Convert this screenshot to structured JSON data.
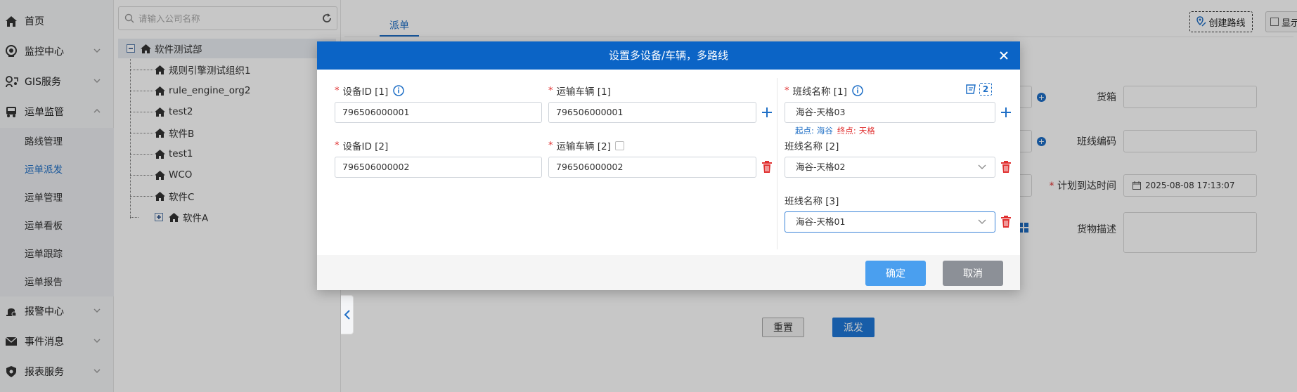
{
  "sidebar": {
    "items": [
      {
        "label": "首页",
        "icon": "home-icon"
      },
      {
        "label": "监控中心",
        "icon": "monitor-icon"
      },
      {
        "label": "GIS服务",
        "icon": "gis-icon"
      },
      {
        "label": "运单监管",
        "icon": "truck-icon"
      },
      {
        "label": "报警中心",
        "icon": "alarm-icon"
      },
      {
        "label": "事件消息",
        "icon": "mail-icon"
      },
      {
        "label": "报表服务",
        "icon": "shield-icon"
      }
    ],
    "subitems": [
      "路线管理",
      "运单派发",
      "运单管理",
      "运单看板",
      "运单跟踪",
      "运单报告"
    ],
    "active_sub": "运单派发"
  },
  "tree": {
    "search_placeholder": "请输入公司名称",
    "root": "软件测试部",
    "children": [
      "规则引擎测试组织1",
      "rule_engine_org2",
      "test2",
      "软件B",
      "test1",
      "WCO",
      "软件C",
      "软件A"
    ]
  },
  "main": {
    "tab": "派单",
    "create_route_label": "创建路线",
    "display_label": "显示",
    "labels": {
      "cargo_box": "货箱",
      "route_code": "班线编码",
      "planned_arrival": "计划到达时间",
      "cargo_desc": "货物描述"
    },
    "planned_arrival_value": "2025-08-08 17:13:07",
    "reset_label": "重置",
    "dispatch_label": "派发"
  },
  "modal": {
    "title": "设置多设备/车辆，多路线",
    "rows": [
      {
        "device_label": "设备ID [1]",
        "device_value": "796506000001",
        "vehicle_label": "运输车辆 [1]",
        "vehicle_value": "796506000001"
      },
      {
        "device_label": "设备ID [2]",
        "device_value": "796506000002",
        "vehicle_label": "运输车辆 [2]",
        "vehicle_value": "796506000002"
      }
    ],
    "routes": [
      {
        "label": "班线名称 [1]",
        "value": "海谷-天格03",
        "start_key": "起点:",
        "start_val": "海谷",
        "end_key": "终点:",
        "end_val": "天格"
      },
      {
        "label": "班线名称 [2]",
        "value": "海谷-天格02"
      },
      {
        "label": "班线名称 [3]",
        "value": "海谷-天格01"
      }
    ],
    "route_count": "2",
    "ok_label": "确定",
    "cancel_label": "取消"
  },
  "colors": {
    "primary": "#0b64c6",
    "accent": "#1f6fc6",
    "danger": "#e03030",
    "ok": "#4a9fef",
    "cancel": "#8c9097"
  }
}
